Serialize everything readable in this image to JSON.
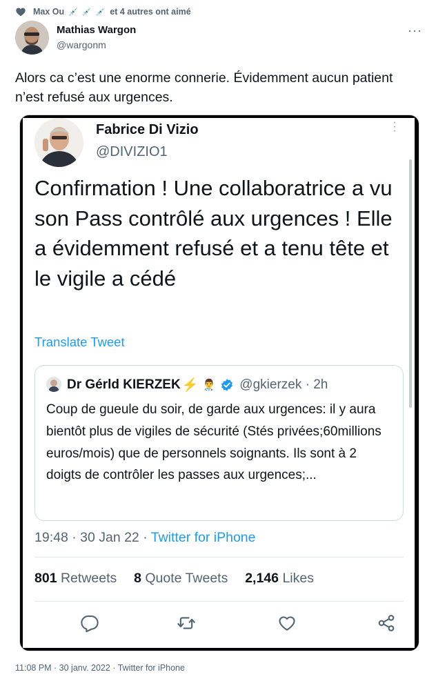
{
  "social_context": {
    "names": "Max Ou",
    "syringes": [
      "💉",
      "💉",
      "💉"
    ],
    "suffix": "et 4 autres ont aimé"
  },
  "author": {
    "name": "Mathias Wargon",
    "handle": "@wargonm"
  },
  "more_label": "···",
  "tweet_text": "Alors ca c’est une enorme connerie. Évidemment aucun patient n’est refusé aux urgences.",
  "screenshot": {
    "author_name": "Fabrice Di Vizio",
    "author_handle": "@DIVIZIO1",
    "text": "Confirmation ! Une collaboratrice a vu son Pass contrôlé aux urgences ! Elle a évidemment refusé et a tenu tête et le vigile a cédé",
    "translate_label": "Translate Tweet",
    "quoted": {
      "name": "Dr Gérld KIERZEK",
      "bolt": "⚡",
      "emoji": "👨‍⚕️",
      "handle_time": "@gkierzek · 2h",
      "text": "Coup de gueule du soir, de garde aux urgences: il y aura bientôt plus de vigiles de sécurité (Stés privées;60millions euros/mois) que de personnels soignants. Ils sont à 2 doigts de contrôler les passes aux urgences;..."
    },
    "meta_time": "19:48 · 30 Jan 22 · ",
    "meta_source": "Twitter for iPhone",
    "retweets_count": "801",
    "retweets_label": "Retweets",
    "quotes_count": "8",
    "quotes_label": "Quote Tweets",
    "likes_count": "2,146",
    "likes_label": "Likes",
    "icons": [
      "reply-icon",
      "retweet-icon",
      "like-icon",
      "share-icon"
    ]
  },
  "footer_meta": "11:08 PM · 30 janv. 2022 · Twitter for iPhone",
  "colors": {
    "text": "#0f1419",
    "secondary": "#536471",
    "accent": "#1d9bf0",
    "border": "#cfd9de"
  }
}
